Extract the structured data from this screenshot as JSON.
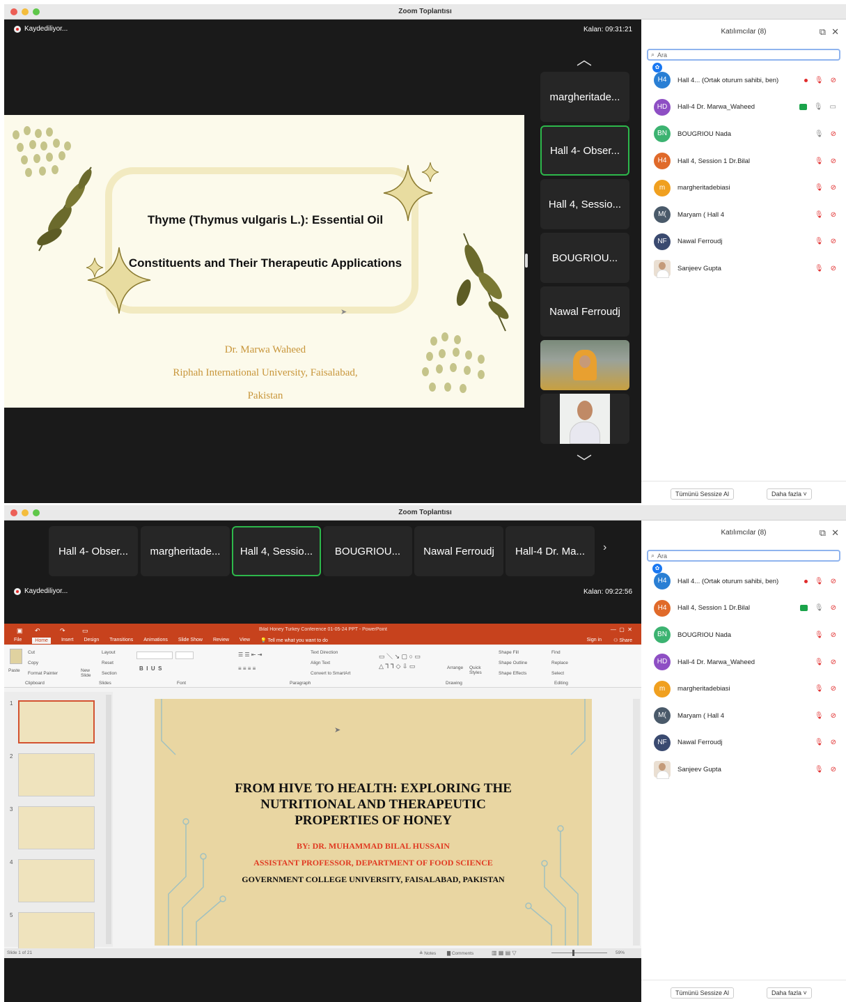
{
  "app": {
    "title": "Zoom Toplantısı"
  },
  "top": {
    "recording": "Kaydediliyor...",
    "timer": "Kalan: 09:31:21",
    "strip": [
      "margheritade...",
      "Hall 4- Obser...",
      "Hall 4, Sessio...",
      "BOUGRIOU...",
      "Nawal Ferroudj"
    ],
    "slide": {
      "title_line1": "Thyme (Thymus vulgaris L.): Essential Oil",
      "title_line2": "Constituents and Their Therapeutic Applications",
      "author": "Dr. Marwa Waheed",
      "affiliation": "Riphah International University, Faisalabad,",
      "country": "Pakistan"
    },
    "panel": {
      "header": "Katılımcılar (8)",
      "search_placeholder": "Ara",
      "participants": [
        {
          "initials": "H4",
          "name": "Hall 4... (Ortak oturum sahibi, ben)",
          "color": "#2a7fd4"
        },
        {
          "initials": "HD",
          "name": "Hall-4 Dr. Marwa_Waheed",
          "color": "#8e4fc4"
        },
        {
          "initials": "BN",
          "name": "BOUGRIOU Nada",
          "color": "#3cb371"
        },
        {
          "initials": "H4",
          "name": "Hall 4, Session 1 Dr.Bilal",
          "color": "#e06a2a"
        },
        {
          "initials": "m",
          "name": "margheritadebiasi",
          "color": "#f0a020"
        },
        {
          "initials": "M(",
          "name": "Maryam ( Hall 4",
          "color": "#4a5a6a"
        },
        {
          "initials": "NF",
          "name": "Nawal Ferroudj",
          "color": "#3a4a70"
        },
        {
          "initials": "",
          "name": "Sanjeev Gupta",
          "color": ""
        }
      ],
      "mute_all": "Tümünü Sessize Al",
      "more": "Daha fazla"
    }
  },
  "bottom": {
    "recording": "Kaydediliyor...",
    "timer": "Kalan: 09:22:56",
    "strip": [
      "Hall 4- Obser...",
      "margheritade...",
      "Hall 4, Sessio...",
      "BOUGRIOU...",
      "Nawal Ferroudj",
      "Hall-4 Dr. Ma..."
    ],
    "ppt": {
      "title": "Bilal Honey Turkey Conference 01-05-24 PPT - PowerPoint",
      "tabs": [
        "File",
        "Home",
        "Insert",
        "Design",
        "Transitions",
        "Animations",
        "Slide Show",
        "Review",
        "View"
      ],
      "tell_me": "Tell me what you want to do",
      "sign_in": "Sign in",
      "share": "Share",
      "ribbon": {
        "paste": "Paste",
        "cut": "Cut",
        "copy": "Copy",
        "format_painter": "Format Painter",
        "clipboard": "Clipboard",
        "new_slide": "New Slide",
        "layout": "Layout",
        "reset": "Reset",
        "section": "Section",
        "slides": "Slides",
        "font": "Font",
        "paragraph": "Paragraph",
        "text_direction": "Text Direction",
        "align_text": "Align Text",
        "smartart": "Convert to SmartArt",
        "arrange": "Arrange",
        "quick_styles": "Quick Styles",
        "drawing": "Drawing",
        "shape_fill": "Shape Fill",
        "shape_outline": "Shape Outline",
        "shape_effects": "Shape Effects",
        "find": "Find",
        "replace": "Replace",
        "select": "Select",
        "editing": "Editing"
      },
      "thumb_numbers": [
        "1",
        "2",
        "3",
        "4",
        "5"
      ],
      "slide": {
        "line1": "FROM HIVE TO HEALTH: EXPLORING THE",
        "line2": "NUTRITIONAL AND THERAPEUTIC",
        "line3": "PROPERTIES OF HONEY",
        "by": "BY: DR. MUHAMMAD BILAL HUSSAIN",
        "position": "ASSISTANT PROFESSOR, DEPARTMENT OF FOOD SCIENCE",
        "college": "GOVERNMENT COLLEGE UNIVERSITY, FAISALABAD, PAKISTAN"
      },
      "status_left": "Slide 1 of 21",
      "notes": "Notes",
      "comments": "Comments",
      "zoom": "59%"
    },
    "panel": {
      "header": "Katılımcılar (8)",
      "search_placeholder": "Ara",
      "participants": [
        {
          "initials": "H4",
          "name": "Hall 4... (Ortak oturum sahibi, ben)",
          "color": "#2a7fd4"
        },
        {
          "initials": "H4",
          "name": "Hall 4, Session 1 Dr.Bilal",
          "color": "#e06a2a"
        },
        {
          "initials": "BN",
          "name": "BOUGRIOU Nada",
          "color": "#3cb371"
        },
        {
          "initials": "HD",
          "name": "Hall-4 Dr. Marwa_Waheed",
          "color": "#8e4fc4"
        },
        {
          "initials": "m",
          "name": "margheritadebiasi",
          "color": "#f0a020"
        },
        {
          "initials": "M(",
          "name": "Maryam ( Hall 4",
          "color": "#4a5a6a"
        },
        {
          "initials": "NF",
          "name": "Nawal Ferroudj",
          "color": "#3a4a70"
        },
        {
          "initials": "",
          "name": "Sanjeev Gupta",
          "color": ""
        }
      ],
      "mute_all": "Tümünü Sessize Al",
      "more": "Daha fazla"
    }
  }
}
